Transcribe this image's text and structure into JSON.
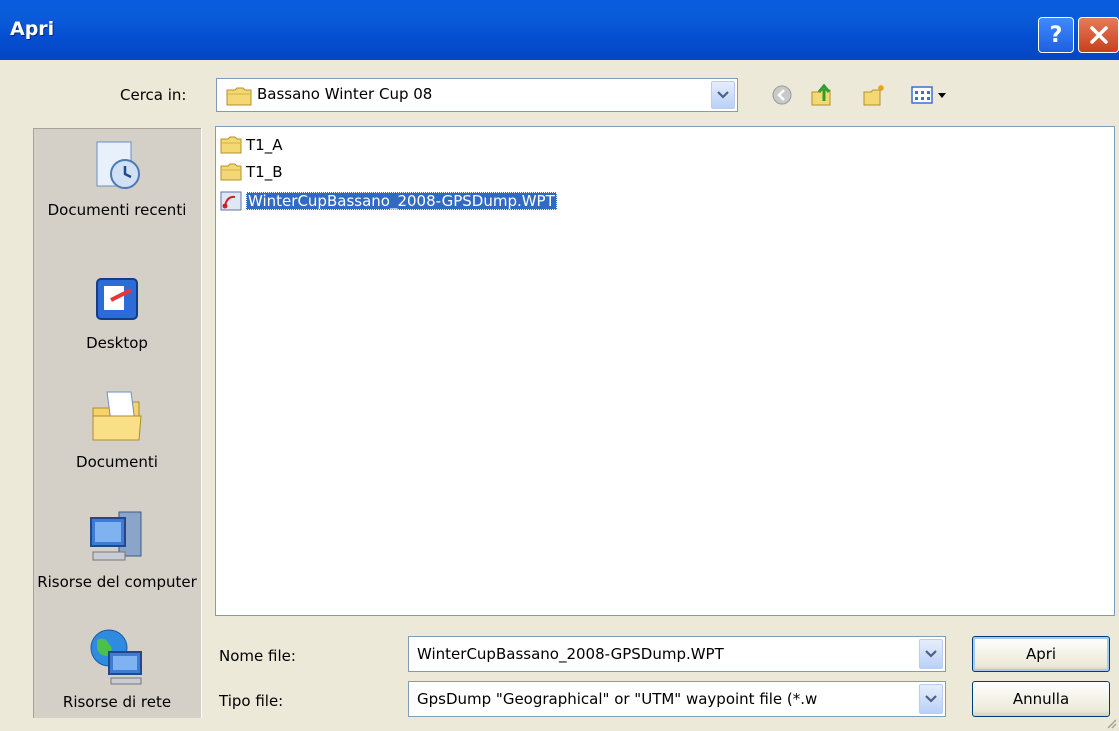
{
  "window": {
    "title": "Apri"
  },
  "titlebar": {
    "help_icon": "help-icon",
    "close_icon": "close-icon"
  },
  "look_in": {
    "label": "Cerca in:",
    "value": "Bassano Winter Cup 08"
  },
  "toolbar": {
    "icons": [
      "back-icon",
      "up-folder-icon",
      "new-folder-icon",
      "view-menu-icon"
    ]
  },
  "places": [
    {
      "label": "Documenti recenti",
      "icon": "recent-documents-icon"
    },
    {
      "label": "Desktop",
      "icon": "desktop-icon"
    },
    {
      "label": "Documenti",
      "icon": "documents-icon"
    },
    {
      "label": "Risorse del computer",
      "icon": "my-computer-icon"
    },
    {
      "label": "Risorse di rete",
      "icon": "network-icon"
    }
  ],
  "files": [
    {
      "name": "T1_A",
      "type": "folder"
    },
    {
      "name": "T1_B",
      "type": "folder"
    },
    {
      "name": "WinterCupBassano_2008-GPSDump.WPT",
      "type": "file",
      "selected": true
    }
  ],
  "filename": {
    "label": "Nome file:",
    "value": "WinterCupBassano_2008-GPSDump.WPT"
  },
  "filetype": {
    "label": "Tipo file:",
    "value": "GpsDump \"Geographical\" or \"UTM\" waypoint file (*.w"
  },
  "buttons": {
    "open": "Apri",
    "cancel": "Annulla"
  },
  "colors": {
    "titlebar": "#0a5ce0",
    "face": "#ece9d8",
    "selection": "#316ac5"
  }
}
